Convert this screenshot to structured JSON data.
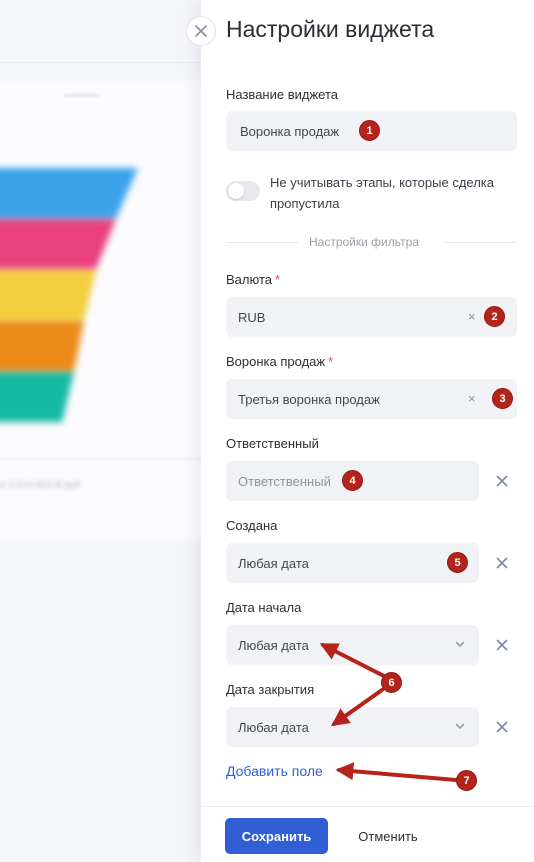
{
  "panel": {
    "title": "Настройки виджета",
    "widget_name_label": "Название виджета",
    "widget_name_value": "Воронка продаж",
    "toggle_text": "Не учитывать этапы, которые сделка пропустила",
    "toggle_on": false,
    "filter_section_title": "Настройки фильтра",
    "add_field_label": "Добавить поле"
  },
  "fields": {
    "currency": {
      "label": "Валюта",
      "required_mark": "*",
      "value": "RUB"
    },
    "pipeline": {
      "label": "Воронка продаж",
      "required_mark": "*",
      "value": "Третья воронка продаж"
    },
    "responsible": {
      "label": "Ответственный",
      "placeholder": "Ответственный"
    },
    "created": {
      "label": "Создана",
      "value": "Любая дата"
    },
    "start_date": {
      "label": "Дата начала",
      "value": "Любая дата"
    },
    "close_date": {
      "label": "Дата закрытия",
      "value": "Любая дата"
    }
  },
  "footer": {
    "save_label": "Сохранить",
    "cancel_label": "Отменить"
  },
  "annotations": [
    "1",
    "2",
    "3",
    "4",
    "5",
    "6",
    "7"
  ],
  "colors": {
    "accent": "#2f5fd3",
    "annotation": "#b5241a",
    "required": "#e8485b",
    "field_bg": "#f1f2f6",
    "funnel": [
      "#3aa3ea",
      "#e9427e",
      "#f2cf3c",
      "#ec8a18",
      "#15b9a4"
    ]
  },
  "background": {
    "caption": "в 3 514 853 ₽ руб"
  }
}
